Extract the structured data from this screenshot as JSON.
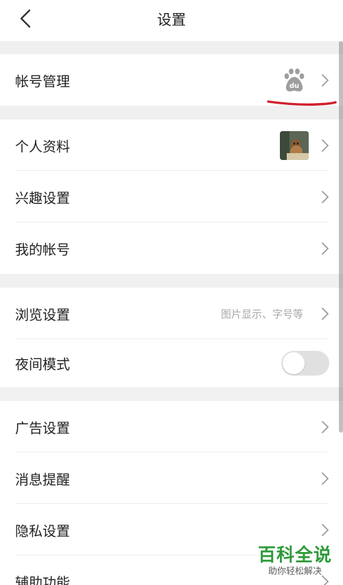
{
  "header": {
    "title": "设置",
    "back_icon": "chevron-left-icon"
  },
  "groups": [
    {
      "rows": [
        {
          "label": "帐号管理",
          "trailing": "baidu-paw-icon"
        }
      ]
    },
    {
      "rows": [
        {
          "label": "个人资料",
          "trailing": "avatar"
        },
        {
          "label": "兴趣设置"
        },
        {
          "label": "我的帐号"
        }
      ]
    },
    {
      "rows": [
        {
          "label": "浏览设置",
          "hint": "图片显示、字号等"
        },
        {
          "label": "夜间模式",
          "toggle": false
        }
      ]
    },
    {
      "rows": [
        {
          "label": "广告设置"
        },
        {
          "label": "消息提醒"
        },
        {
          "label": "隐私设置"
        },
        {
          "label": "辅助功能"
        }
      ]
    }
  ],
  "account_icon": {
    "name": "baidu-paw-icon",
    "text": "du",
    "color": "#9e9e9e"
  },
  "annotation": {
    "color": "#d0202f"
  },
  "watermark": {
    "title": "百科全说",
    "subtitle": "助你轻松解决",
    "title_color": "#2e9a3a"
  },
  "colors": {
    "background": "#f0f0f0",
    "card": "#ffffff",
    "text": "#222222",
    "hint": "#a8a8a8",
    "toggle_off": "#e0e0e0"
  }
}
